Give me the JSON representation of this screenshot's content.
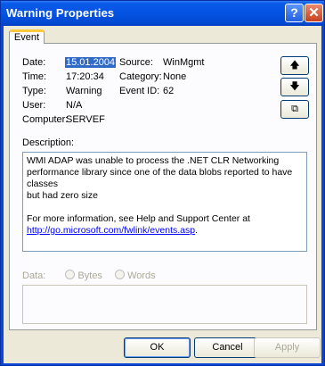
{
  "window": {
    "title": "Warning Properties",
    "help_glyph": "?",
    "close_glyph": "✕"
  },
  "tabs": [
    {
      "label": "Event"
    }
  ],
  "event": {
    "date_label": "Date:",
    "date_value": "15.01.2004",
    "time_label": "Time:",
    "time_value": "17:20:34",
    "type_label": "Type:",
    "type_value": "Warning",
    "user_label": "User:",
    "user_value": "N/A",
    "computer_label": "Computer:",
    "computer_value": "SERVEF",
    "source_label": "Source:",
    "source_value": "WinMgmt",
    "category_label": "Category:",
    "category_value": "None",
    "eventid_label": "Event ID:",
    "eventid_value": "62"
  },
  "side_buttons": {
    "up_glyph": "🡅",
    "down_glyph": "🡇",
    "copy_glyph": "⧉"
  },
  "description": {
    "label": "Description:",
    "text_line1": "WMI ADAP was unable to process the .NET CLR Networking",
    "text_line2": "performance library since one of the data blobs reported to have classes",
    "text_line3": "but had zero size",
    "text_line4": "For more information, see Help and Support Center at",
    "link": "http://go.microsoft.com/fwlink/events.asp",
    "link_suffix": "."
  },
  "data_section": {
    "label": "Data:",
    "bytes_label": "Bytes",
    "words_label": "Words"
  },
  "buttons": {
    "ok": "OK",
    "cancel": "Cancel",
    "apply": "Apply"
  }
}
